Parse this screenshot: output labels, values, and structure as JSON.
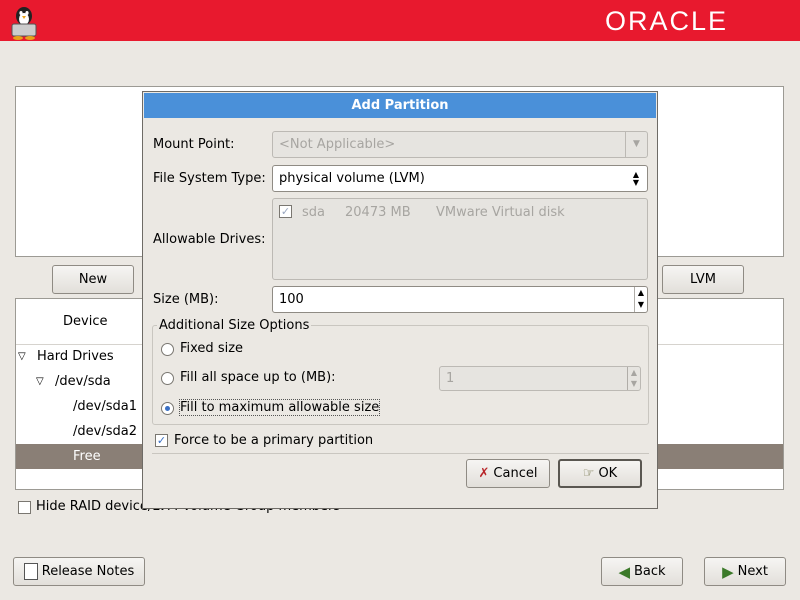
{
  "brand": {
    "logo_text": "ORACLE",
    "left_icon": "tux-installer-icon",
    "bar_color": "#e8192e"
  },
  "main": {
    "buttons": {
      "new": "New",
      "lvm": "LVM"
    },
    "tree": {
      "column_header": "Device",
      "rows": [
        "Hard Drives",
        "/dev/sda",
        "/dev/sda1",
        "/dev/sda2",
        "Free"
      ],
      "selected": "Free"
    },
    "hide_raid_label": "Hide RAID device/LVM Volume Group members"
  },
  "footer": {
    "release_notes": "Release Notes",
    "back": "Back",
    "next": "Next"
  },
  "dialog": {
    "title": "Add Partition",
    "mount_point": {
      "label": "Mount Point:",
      "value": "<Not Applicable>"
    },
    "fs_type": {
      "label": "File System Type:",
      "value": "physical volume (LVM)"
    },
    "drives": {
      "label": "Allowable Drives:",
      "items": [
        {
          "name": "sda",
          "size": "20473 MB",
          "model": "VMware Virtual disk",
          "checked": true
        }
      ]
    },
    "size": {
      "label": "Size (MB):",
      "value": "100"
    },
    "options": {
      "title": "Additional Size Options",
      "fixed": "Fixed size",
      "fill_upto": "Fill all space up to (MB):",
      "fill_upto_value": "1",
      "fill_max": "Fill to maximum allowable size",
      "selected": "fill_max"
    },
    "primary": {
      "label": "Force to be a primary partition",
      "checked": true
    },
    "cancel": "Cancel",
    "ok": "OK"
  }
}
